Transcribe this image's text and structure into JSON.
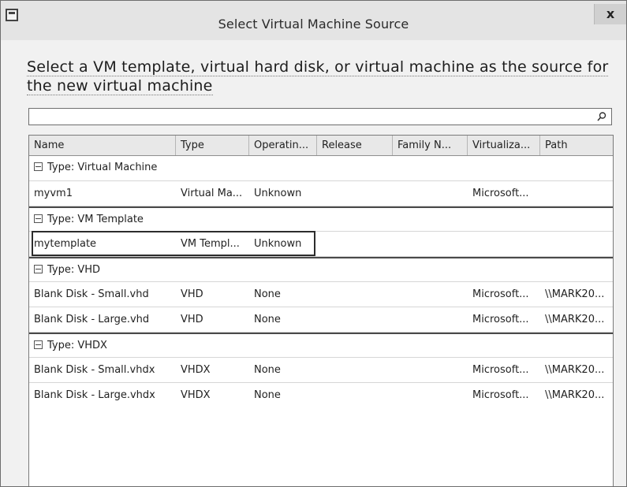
{
  "window": {
    "title": "Select Virtual Machine Source",
    "close": "x"
  },
  "heading": "Select a VM template, virtual hard disk, or virtual machine as the source for the new virtual machine",
  "search": {
    "value": "",
    "placeholder": ""
  },
  "columns": [
    "Name",
    "Type",
    "Operatin...",
    "Release",
    "Family N...",
    "Virtualiza...",
    "Path"
  ],
  "groups": [
    {
      "label": "Type:  Virtual Machine",
      "rows": [
        [
          "myvm1",
          "Virtual Ma...",
          "Unknown",
          "",
          "",
          "Microsoft...",
          ""
        ]
      ]
    },
    {
      "label": "Type:  VM Template",
      "rows": [
        [
          "mytemplate",
          "VM Templ...",
          "Unknown",
          "",
          "",
          "",
          ""
        ]
      ]
    },
    {
      "label": "Type:  VHD",
      "rows": [
        [
          "Blank Disk - Small.vhd",
          "VHD",
          "None",
          "",
          "",
          "Microsoft...",
          "\\\\MARK20..."
        ],
        [
          "Blank Disk - Large.vhd",
          "VHD",
          "None",
          "",
          "",
          "Microsoft...",
          "\\\\MARK20..."
        ]
      ]
    },
    {
      "label": "Type:  VHDX",
      "rows": [
        [
          "Blank Disk - Small.vhdx",
          "VHDX",
          "None",
          "",
          "",
          "Microsoft...",
          "\\\\MARK20..."
        ],
        [
          "Blank Disk - Large.vhdx",
          "VHDX",
          "None",
          "",
          "",
          "Microsoft...",
          "\\\\MARK20..."
        ]
      ]
    }
  ],
  "selected_item": "mytemplate"
}
